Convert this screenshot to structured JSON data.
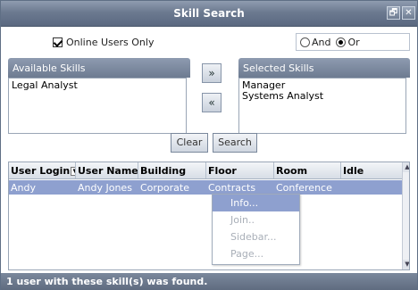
{
  "window": {
    "title": "Skill Search",
    "restore_glyph": "🗗",
    "close_glyph": "✕"
  },
  "filters": {
    "online_only_label": "Online Users Only",
    "online_only_checked": true,
    "and_label": "And",
    "or_label": "Or",
    "selected_logic": "Or"
  },
  "available_skills": {
    "title": "Available Skills",
    "items": [
      "Legal Analyst"
    ]
  },
  "selected_skills": {
    "title": "Selected Skills",
    "items": [
      "Manager",
      "Systems Analyst"
    ]
  },
  "transfer": {
    "add_glyph": "»",
    "remove_glyph": "«"
  },
  "actions": {
    "clear_label": "Clear",
    "search_label": "Search"
  },
  "results": {
    "columns": [
      "User Login",
      "User Name",
      "Building",
      "Floor",
      "Room",
      "Idle"
    ],
    "rows": [
      {
        "login": "Andy",
        "name": "Andy Jones",
        "building": "Corporate",
        "floor": "Contracts",
        "room": "Conference",
        "idle": ""
      }
    ]
  },
  "context_menu": {
    "items": [
      "Info...",
      "Join..",
      "Sidebar...",
      "Page..."
    ],
    "active_index": 0
  },
  "status": {
    "text": "1 user with these skill(s) was found."
  },
  "colors": {
    "titlebar": "#6c7a90",
    "selection": "#8ea0cf",
    "statusbar": "#5f6c80"
  }
}
